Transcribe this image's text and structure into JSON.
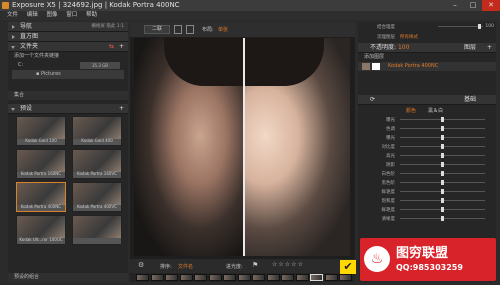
{
  "app": {
    "title": "Exposure X5 | 324692.jpg | Kodak Portra 400NC"
  },
  "menu": [
    "文件",
    "编辑",
    "图像",
    "窗口",
    "帮助"
  ],
  "left_panel": {
    "nav_label": "导航",
    "top_icons": [
      "栅格屏",
      "筋此",
      "1:1"
    ],
    "histogram_label": "直方图",
    "folders_label": "文件夹",
    "add_folder_hint": "添加一个文件夹链接",
    "drive": "C:",
    "drive_size": "35.3 GB",
    "pictures": "Pictures",
    "collections_label": "集合",
    "presets_label": "预设",
    "presets_search": "搜索",
    "preset_items": [
      {
        "label": "Kodak Gold 100"
      },
      {
        "label": "Kodak Gold 400"
      },
      {
        "label": "Kodak Portra 160NC"
      },
      {
        "label": "Kodak Portra 160VC"
      },
      {
        "label": "Kodak Portra 400NC",
        "selected": true
      },
      {
        "label": "Kodak Portra 400VC"
      },
      {
        "label": "Kodak Ult...ror 100UC"
      },
      {
        "label": ""
      }
    ],
    "recent_label": "预设的组合"
  },
  "center": {
    "view_button": "二联",
    "layout_label": "布局:",
    "layout_value": "单张",
    "bottom_bar": {
      "sort_label": "排序:",
      "sort_value": "文件名",
      "filter_label": "进光度:",
      "stars": [
        "☆",
        "☆",
        "☆",
        "☆",
        "☆"
      ]
    },
    "filmstrip_count": 15
  },
  "right_panel": {
    "tone_label": "结合理度",
    "tone_value": "100",
    "layer_name_label": "流理图层",
    "layer_name_value": "所有样式",
    "opacity_label": "不透明度:",
    "opacity_value": "100",
    "layers_label": "图层",
    "add_layer_label": "添加图层",
    "layer_item": "Kodak Portra 400NC",
    "basic_label": "基础",
    "tab_color": "颜色",
    "tab_bw": "黑＆白",
    "sliders": [
      {
        "label": "曝光",
        "value": 0.5
      },
      {
        "label": "色调",
        "value": 0.5
      },
      {
        "label": "曝光",
        "value": 0.5
      },
      {
        "label": "对比度",
        "value": 0.5
      },
      {
        "label": "高光",
        "value": 0.5
      },
      {
        "label": "阴影",
        "value": 0.5
      },
      {
        "label": "白色阶",
        "value": 0.5
      },
      {
        "label": "黑色阶",
        "value": 0.5
      },
      {
        "label": "鲜艳度",
        "value": 0.5
      },
      {
        "label": "饱和度",
        "value": 0.5
      },
      {
        "label": "鲜艳度",
        "value": 0.5
      },
      {
        "label": "清晰度",
        "value": 0.5
      }
    ]
  },
  "watermark": {
    "line1": "图穷联盟",
    "line2": "QQ:985303259",
    "color": "#d8232a"
  }
}
